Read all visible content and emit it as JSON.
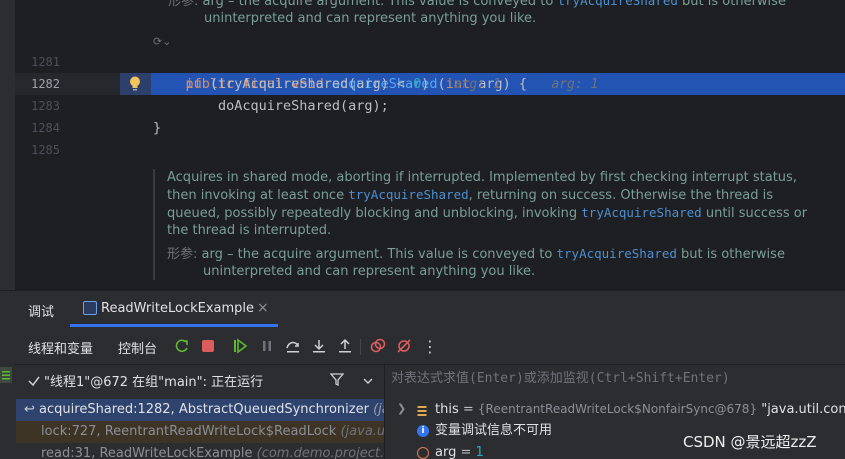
{
  "editor": {
    "top_doc": {
      "params_tag": "形参:",
      "line1_pre": "arg – the acquire argument. This value is conveyed to ",
      "line1_link": "tryAcquireShared",
      "line1_post": " but is otherwise",
      "line2": "uninterpreted and can represent anything you like."
    },
    "reader_mode_hint": "⟳⌄",
    "lines": [
      {
        "num": "1281"
      },
      {
        "num": "1282"
      },
      {
        "num": "1283"
      },
      {
        "num": "1284"
      },
      {
        "num": "1285"
      }
    ],
    "code": {
      "l1_kw1": "public",
      "l1_kw2": "final",
      "l1_kw3": "void",
      "l1_fn": "acquireShared",
      "l1_paren_open": "(",
      "l1_type": "int",
      "l1_rest": " arg) {",
      "l1_hint": "arg: 1",
      "l2_kw": "if",
      "l2_mid": " (tryAcquireShared(arg) < ",
      "l2_num": "0",
      "l2_end": ")",
      "l2_hint": "arg: 1",
      "l3": "doAcquireShared(arg);",
      "l4": "}"
    },
    "bottom_doc": {
      "p1": "Acquires in shared mode, aborting if interrupted. Implemented by first checking interrupt status,",
      "p2_pre": "then invoking at least once ",
      "p2_link": "tryAcquireShared",
      "p2_post": ", returning on success. Otherwise the thread is",
      "p3_pre": "queued, possibly repeatedly blocking and unblocking, invoking ",
      "p3_link": "tryAcquireShared",
      "p3_post": " until success or",
      "p4": "the thread is interrupted.",
      "params_tag": "形参:",
      "param_pre": "arg – the acquire argument. This value is conveyed to ",
      "param_link": "tryAcquireShared",
      "param_post": " but is otherwise",
      "param_line2": "uninterpreted and can represent anything you like."
    }
  },
  "debug": {
    "tabs": {
      "debug_label": "调试",
      "session_label": "ReadWriteLockExample",
      "close": "×"
    },
    "toolbar": {
      "threads_vars": "线程和变量",
      "console": "控制台",
      "more": "⋮"
    },
    "thread": {
      "label": "\"线程1\"@672 在组\"main\": 正在运行"
    },
    "frames": [
      {
        "text": "acquireShared:1282, AbstractQueuedSynchronizer",
        "italic": " (java."
      },
      {
        "text": "lock:727, ReentrantReadWriteLock$ReadLock",
        "italic": " (java.util."
      },
      {
        "text": "read:31, ReadWriteLockExample",
        "italic": " (com.demo.project.de"
      }
    ],
    "watch_placeholder": "对表达式求值(Enter)或添加监视(Ctrl+Shift+Enter)",
    "vars": [
      {
        "name": "this",
        "eq": " = ",
        "value": "{ReentrantReadWriteLock$NonfairSync@678}",
        "extra": " \"java.util.conc"
      },
      {
        "info": "变量调试信息不可用"
      },
      {
        "name": "arg",
        "eq": " = ",
        "value": "1"
      }
    ],
    "watermark": "CSDN @景远超zzZ"
  },
  "colors": {
    "accent": "#3574f0",
    "highlight_line": "#2454b3"
  }
}
